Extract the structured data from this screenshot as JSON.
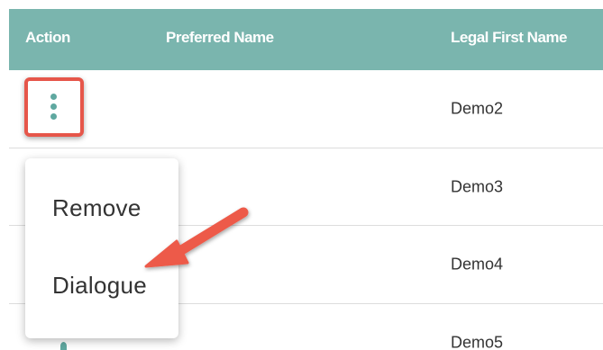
{
  "table": {
    "columns": [
      "Action",
      "Preferred Name",
      "Legal First Name"
    ],
    "rows": [
      {
        "preferred_name": "",
        "legal_first_name": "Demo2"
      },
      {
        "preferred_name": "",
        "legal_first_name": "Demo3"
      },
      {
        "preferred_name": "",
        "legal_first_name": "Demo4"
      },
      {
        "preferred_name": "",
        "legal_first_name": "Demo5"
      }
    ]
  },
  "action_menu": {
    "items": [
      "Remove",
      "Dialogue"
    ]
  },
  "icons": {
    "row_action": "kebab-vertical-icon",
    "annotation": "arrow-icon"
  },
  "colors": {
    "header_bg": "#7ab5ae",
    "header_text": "#ffffff",
    "kebab": "#5fa8a0",
    "highlight": "#e6564a"
  }
}
